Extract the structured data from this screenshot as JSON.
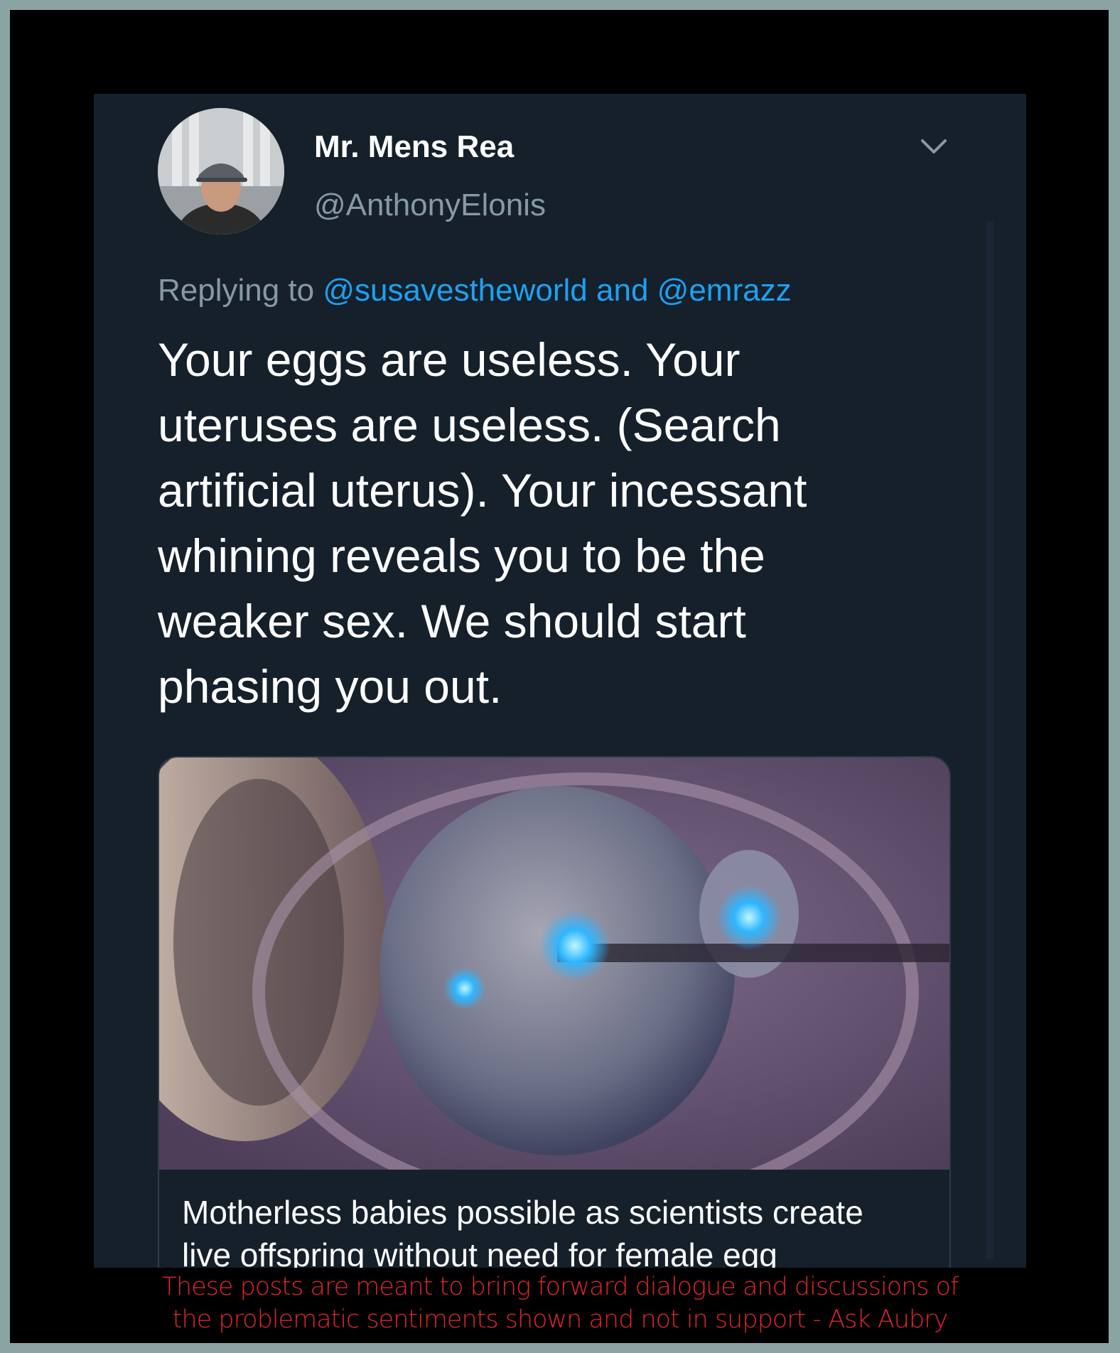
{
  "tweet": {
    "display_name": "Mr. Mens Rea",
    "handle": "@AnthonyElonis",
    "avatar_icon": "profile-photo",
    "menu_icon": "chevron-down-icon",
    "replying_prefix": "Replying to",
    "reply_mention_1": "@susavestheworld",
    "reply_joiner": "and",
    "reply_mention_2": "@emrazz",
    "text": "Your eggs are useless. Your\nuteruses are useless. (Search\nartificial uterus). Your incessant\nwhining reveals you to be the\nweaker sex. We should start\nphasing you out.",
    "card": {
      "title": "Motherless babies possible as scientists create\nlive offspring without need for female egg"
    }
  },
  "footer": {
    "line_1": "These posts are meant to bring forward dialogue and discussions of",
    "line_2": "the problematic sentiments shown and not in support - Ask Aubry"
  },
  "colors": {
    "background": "#15202b",
    "mention": "#1da1f2",
    "muted": "#8899a6",
    "footer_text": "#e0262b",
    "border": "#8aa3a3"
  }
}
